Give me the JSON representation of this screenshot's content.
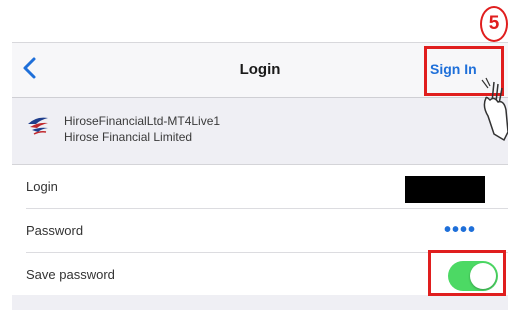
{
  "navbar": {
    "title": "Login",
    "sign_in_label": "Sign In"
  },
  "server": {
    "name": "HiroseFinancialLtd-MT4Live1",
    "company": "Hirose Financial Limited"
  },
  "form": {
    "login_label": "Login",
    "password_label": "Password",
    "password_value": "••••",
    "save_password_label": "Save password",
    "save_password_enabled": true
  },
  "annotation": {
    "step_number": "5",
    "highlight_color": "#e01e1e"
  },
  "colors": {
    "accent": "#1e6fd9",
    "toggle_on": "#4cd964"
  },
  "icons": [
    "chevron-left-icon",
    "broker-logo-icon",
    "pointing-hand-icon"
  ]
}
